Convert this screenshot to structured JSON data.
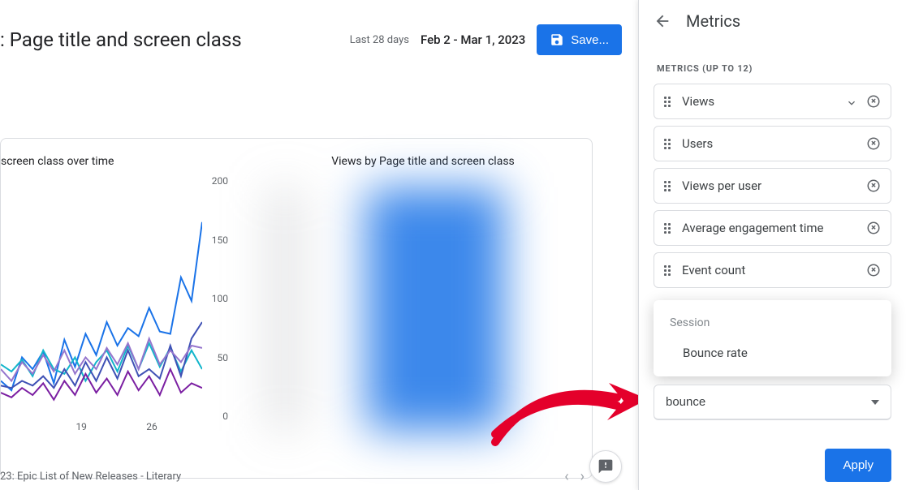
{
  "header": {
    "page_title": ": Page title and screen class",
    "range_label": "Last 28 days",
    "range_value": "Feb 2 - Mar 1, 2023",
    "save_label": "Save..."
  },
  "charts": {
    "left_title": "screen class over time",
    "right_title": "Views by Page title and screen class"
  },
  "chart_data": {
    "type": "line",
    "title": "screen class over time",
    "xlabel": "",
    "ylabel": "",
    "ylim": [
      0,
      200
    ],
    "y_ticks": [
      0,
      50,
      100,
      150,
      200
    ],
    "x_ticks": [
      "19",
      "26"
    ],
    "series": [
      {
        "name": "series-blue-dark",
        "color": "#1a73e8",
        "values": [
          30,
          22,
          50,
          40,
          55,
          28,
          65,
          42,
          70,
          52,
          80,
          60,
          75,
          68,
          92,
          72,
          70,
          118,
          98,
          165
        ]
      },
      {
        "name": "series-cyan",
        "color": "#12b5cb",
        "values": [
          44,
          38,
          48,
          34,
          56,
          40,
          36,
          50,
          30,
          46,
          56,
          38,
          60,
          40,
          62,
          42,
          58,
          38,
          56,
          40
        ]
      },
      {
        "name": "series-violet",
        "color": "#7b1fa2",
        "values": [
          20,
          16,
          24,
          18,
          28,
          14,
          30,
          18,
          36,
          20,
          32,
          18,
          38,
          22,
          34,
          18,
          40,
          20,
          28,
          24
        ]
      },
      {
        "name": "series-indigo",
        "color": "#3f51b5",
        "values": [
          26,
          24,
          30,
          26,
          34,
          24,
          40,
          26,
          46,
          30,
          50,
          32,
          56,
          34,
          40,
          32,
          60,
          34,
          66,
          80
        ]
      },
      {
        "name": "series-lav",
        "color": "#9575cd",
        "values": [
          40,
          30,
          46,
          36,
          52,
          38,
          56,
          36,
          50,
          40,
          58,
          44,
          62,
          40,
          66,
          44,
          56,
          46,
          60,
          58
        ]
      }
    ]
  },
  "footer": {
    "caption": "23: Epic List of New Releases - Literary"
  },
  "panel": {
    "title": "Metrics",
    "subtitle": "METRICS (UP TO 12)",
    "metrics": [
      {
        "label": "Views",
        "sorted": true
      },
      {
        "label": "Users"
      },
      {
        "label": "Views per user"
      },
      {
        "label": "Average engagement time"
      },
      {
        "label": "Event count"
      }
    ],
    "dropdown": {
      "group": "Session",
      "option": "Bounce rate"
    },
    "search_value": "bounce",
    "apply_label": "Apply"
  }
}
